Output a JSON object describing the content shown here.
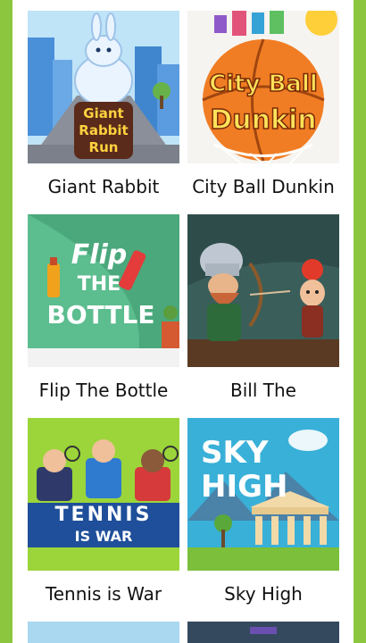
{
  "games": [
    {
      "title": "Giant Rabbit",
      "art_text": [
        "Giant",
        "Rabbit",
        "Run"
      ]
    },
    {
      "title": "City Ball Dunkin",
      "art_text": [
        "City Ball",
        "Dunkin"
      ]
    },
    {
      "title": "Flip The Bottle",
      "art_text": [
        "Flip",
        "THE",
        "BOTTLE"
      ]
    },
    {
      "title": "Bill The",
      "art_text": []
    },
    {
      "title": "Tennis is War",
      "art_text": [
        "TENNIS",
        "IS WAR"
      ]
    },
    {
      "title": "Sky High",
      "art_text": [
        "SKY",
        "HIGH"
      ]
    }
  ],
  "colors": {
    "frame": "#8cc63f",
    "card_bg": "#ffffff",
    "title_text": "#111111"
  }
}
